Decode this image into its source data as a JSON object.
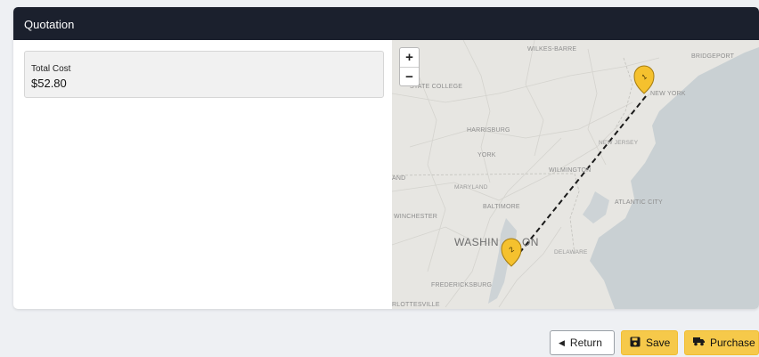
{
  "panel": {
    "title": "Quotation"
  },
  "cost": {
    "label": "Total Cost",
    "value": "$52.80"
  },
  "map": {
    "zoom_in": "+",
    "zoom_out": "−",
    "cities": {
      "wilkes_barre": "WILKES-BARRE",
      "bridgeport": "BRIDGEPORT",
      "state_college": "STATE COLLEGE",
      "new_york": "NEW YORK",
      "harrisburg": "HARRISBURG",
      "new_jersey": "NEW JERSEY",
      "york": "YORK",
      "wilmington": "WILMINGTON",
      "maryland": "MARYLAND",
      "atlantic_city": "ATLANTIC CITY",
      "baltimore": "BALTIMORE",
      "winchester": "WINCHESTER",
      "washington": "WASHIN",
      "washington_end": "ON",
      "delaware": "DELAWARE",
      "fredericksburg": "FREDERICKSBURG",
      "charlottesville": "RLOTTESVILLE",
      "and": "AND"
    },
    "markers": {
      "start": "1",
      "end": "2"
    },
    "colors": {
      "marker": "#f5c12e",
      "route": "#1a1a1a",
      "water": "#c9d0d3",
      "land": "#e7e6e2"
    }
  },
  "actions": {
    "return": "Return",
    "save": "Save",
    "purchase": "Purchase"
  },
  "colors": {
    "header": "#1b202d",
    "accent": "#f6c94a"
  }
}
